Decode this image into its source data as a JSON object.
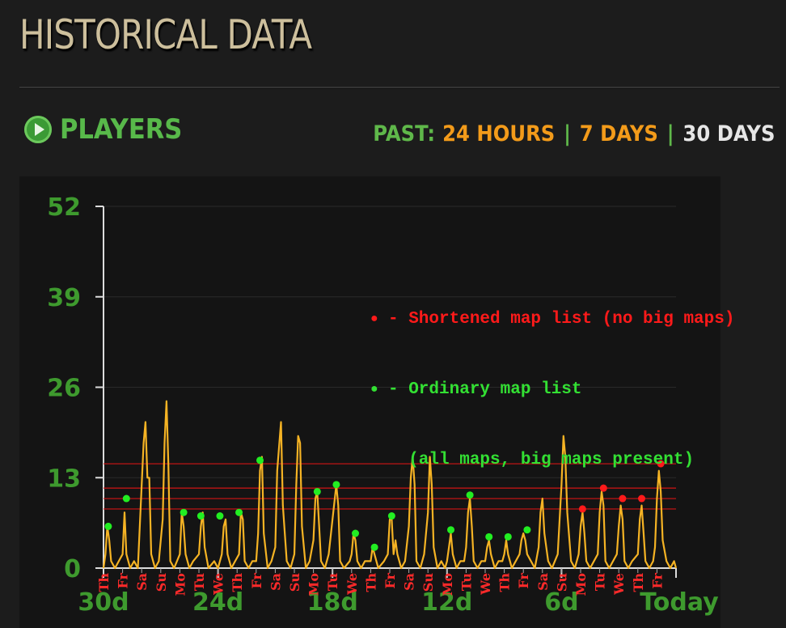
{
  "page": {
    "title": "HISTORICAL DATA"
  },
  "section": {
    "title": "PLAYERS"
  },
  "period_nav": {
    "label": "PAST:",
    "options": [
      {
        "label": "24 HOURS",
        "active": false
      },
      {
        "label": "7 DAYS",
        "active": false
      },
      {
        "label": "30 DAYS",
        "active": true
      }
    ],
    "separator": "|"
  },
  "legend": {
    "red_text": "- Shortened map list (no big maps)",
    "green_text_1": "- Ordinary map list",
    "green_text_2": "  (all maps, big maps present)"
  },
  "colors": {
    "line": "#f5b324",
    "axis_labels": "#3e9a2e",
    "day_labels": "#ff2a2a",
    "red_marker": "#ff1a1a",
    "green_marker": "#22ee22",
    "reference_line": "#d01515"
  },
  "chart_data": {
    "type": "line",
    "ylim": [
      0,
      52
    ],
    "yticks": [
      "0",
      "13",
      "26",
      "39",
      "52"
    ],
    "xlim": [
      0,
      30
    ],
    "x_major_labels": [
      {
        "x": 0,
        "label": "30d"
      },
      {
        "x": 6,
        "label": "24d"
      },
      {
        "x": 12,
        "label": "18d"
      },
      {
        "x": 18,
        "label": "12d"
      },
      {
        "x": 24,
        "label": "6d"
      },
      {
        "x": 30,
        "label": "Today"
      }
    ],
    "day_labels": [
      "Th",
      "Fr",
      "Sa",
      "Su",
      "Mo",
      "Tu",
      "We",
      "Th",
      "Fr",
      "Sa",
      "Su",
      "Mo",
      "Tu",
      "We",
      "Th",
      "Fr",
      "Sa",
      "Su",
      "Mo",
      "Tu",
      "We",
      "Th",
      "Fr",
      "Sa",
      "Su",
      "Mo",
      "Tu",
      "We",
      "Th",
      "Fr"
    ],
    "series": [
      {
        "values": [
          [
            0,
            0
          ],
          [
            0.1,
            2
          ],
          [
            0.2,
            6
          ],
          [
            0.3,
            4
          ],
          [
            0.4,
            1
          ],
          [
            0.6,
            0
          ],
          [
            0.8,
            1
          ],
          [
            1,
            2
          ],
          [
            1.1,
            8
          ],
          [
            1.2,
            2
          ],
          [
            1.4,
            0
          ],
          [
            1.6,
            1
          ],
          [
            1.8,
            0
          ],
          [
            2.1,
            18
          ],
          [
            2.2,
            21
          ],
          [
            2.3,
            13
          ],
          [
            2.4,
            13
          ],
          [
            2.5,
            2
          ],
          [
            2.7,
            0
          ],
          [
            2.9,
            1
          ],
          [
            3.1,
            7
          ],
          [
            3.2,
            18
          ],
          [
            3.3,
            24
          ],
          [
            3.4,
            15
          ],
          [
            3.5,
            1
          ],
          [
            3.7,
            0
          ],
          [
            4,
            2
          ],
          [
            4.1,
            8
          ],
          [
            4.2,
            6
          ],
          [
            4.3,
            2
          ],
          [
            4.5,
            0
          ],
          [
            4.7,
            1
          ],
          [
            5,
            2
          ],
          [
            5.1,
            6
          ],
          [
            5.2,
            8
          ],
          [
            5.3,
            3
          ],
          [
            5.5,
            0
          ],
          [
            5.8,
            1
          ],
          [
            6,
            0
          ],
          [
            6.2,
            2
          ],
          [
            6.3,
            6
          ],
          [
            6.4,
            7
          ],
          [
            6.5,
            2
          ],
          [
            6.7,
            0
          ],
          [
            6.9,
            1
          ],
          [
            7.1,
            2
          ],
          [
            7.2,
            8
          ],
          [
            7.3,
            7
          ],
          [
            7.4,
            1
          ],
          [
            7.6,
            0
          ],
          [
            7.8,
            1
          ],
          [
            8,
            1
          ],
          [
            8.1,
            5
          ],
          [
            8.2,
            14
          ],
          [
            8.3,
            16
          ],
          [
            8.4,
            5
          ],
          [
            8.6,
            0
          ],
          [
            8.8,
            1
          ],
          [
            9,
            3
          ],
          [
            9.1,
            14
          ],
          [
            9.3,
            21
          ],
          [
            9.4,
            9
          ],
          [
            9.6,
            1
          ],
          [
            9.8,
            0
          ],
          [
            10,
            2
          ],
          [
            10.1,
            12
          ],
          [
            10.2,
            19
          ],
          [
            10.3,
            18
          ],
          [
            10.4,
            6
          ],
          [
            10.6,
            0
          ],
          [
            10.8,
            1
          ],
          [
            11,
            4
          ],
          [
            11.1,
            10
          ],
          [
            11.2,
            11
          ],
          [
            11.3,
            6
          ],
          [
            11.4,
            1
          ],
          [
            11.6,
            0
          ],
          [
            11.8,
            2
          ],
          [
            12,
            7
          ],
          [
            12.2,
            12
          ],
          [
            12.3,
            9
          ],
          [
            12.4,
            1
          ],
          [
            12.6,
            0
          ],
          [
            12.9,
            1
          ],
          [
            13,
            2
          ],
          [
            13.1,
            5
          ],
          [
            13.2,
            4
          ],
          [
            13.3,
            1
          ],
          [
            13.5,
            0
          ],
          [
            13.7,
            1
          ],
          [
            14,
            1
          ],
          [
            14.1,
            3
          ],
          [
            14.2,
            2
          ],
          [
            14.4,
            0
          ],
          [
            14.7,
            1
          ],
          [
            14.9,
            2
          ],
          [
            15,
            7
          ],
          [
            15.1,
            7
          ],
          [
            15.2,
            2
          ],
          [
            15.3,
            4
          ],
          [
            15.4,
            2
          ],
          [
            15.6,
            0
          ],
          [
            15.8,
            1
          ],
          [
            16,
            6
          ],
          [
            16.1,
            13
          ],
          [
            16.2,
            16
          ],
          [
            16.3,
            12
          ],
          [
            16.4,
            1
          ],
          [
            16.6,
            0
          ],
          [
            16.8,
            2
          ],
          [
            17,
            8
          ],
          [
            17.1,
            16
          ],
          [
            17.2,
            12
          ],
          [
            17.3,
            3
          ],
          [
            17.5,
            0
          ],
          [
            17.7,
            1
          ],
          [
            17.9,
            0
          ],
          [
            18,
            1
          ],
          [
            18.1,
            3
          ],
          [
            18.2,
            5
          ],
          [
            18.3,
            2
          ],
          [
            18.5,
            0
          ],
          [
            18.7,
            1
          ],
          [
            18.9,
            1
          ],
          [
            19,
            3
          ],
          [
            19.1,
            8
          ],
          [
            19.2,
            10
          ],
          [
            19.3,
            6
          ],
          [
            19.4,
            1
          ],
          [
            19.6,
            0
          ],
          [
            19.8,
            1
          ],
          [
            20,
            1
          ],
          [
            20.1,
            3
          ],
          [
            20.2,
            4
          ],
          [
            20.3,
            2
          ],
          [
            20.5,
            0
          ],
          [
            20.7,
            1
          ],
          [
            20.9,
            1
          ],
          [
            21,
            2
          ],
          [
            21.1,
            4
          ],
          [
            21.2,
            2
          ],
          [
            21.4,
            0
          ],
          [
            21.6,
            1
          ],
          [
            21.8,
            2
          ],
          [
            21.9,
            4
          ],
          [
            22,
            5
          ],
          [
            22.1,
            4
          ],
          [
            22.2,
            2
          ],
          [
            22.4,
            1
          ],
          [
            22.6,
            0
          ],
          [
            22.8,
            3
          ],
          [
            22.9,
            8
          ],
          [
            23,
            10
          ],
          [
            23.1,
            5
          ],
          [
            23.3,
            1
          ],
          [
            23.5,
            0
          ],
          [
            23.8,
            2
          ],
          [
            24,
            12
          ],
          [
            24.1,
            19
          ],
          [
            24.2,
            16
          ],
          [
            24.3,
            8
          ],
          [
            24.5,
            1
          ],
          [
            24.7,
            0
          ],
          [
            24.9,
            2
          ],
          [
            25,
            6
          ],
          [
            25.1,
            8
          ],
          [
            25.2,
            5
          ],
          [
            25.3,
            1
          ],
          [
            25.5,
            0
          ],
          [
            25.7,
            1
          ],
          [
            25.9,
            2
          ],
          [
            26,
            8
          ],
          [
            26.1,
            11
          ],
          [
            26.2,
            9
          ],
          [
            26.3,
            1
          ],
          [
            26.5,
            0
          ],
          [
            26.7,
            1
          ],
          [
            26.9,
            2
          ],
          [
            27,
            6
          ],
          [
            27.1,
            9
          ],
          [
            27.2,
            7
          ],
          [
            27.3,
            1
          ],
          [
            27.5,
            0
          ],
          [
            27.7,
            1
          ],
          [
            28,
            2
          ],
          [
            28.1,
            7
          ],
          [
            28.2,
            9
          ],
          [
            28.3,
            5
          ],
          [
            28.4,
            1
          ],
          [
            28.6,
            0
          ],
          [
            28.8,
            1
          ],
          [
            28.9,
            3
          ],
          [
            29,
            10
          ],
          [
            29.1,
            14
          ],
          [
            29.2,
            11
          ],
          [
            29.3,
            4
          ],
          [
            29.5,
            1
          ],
          [
            29.7,
            0
          ],
          [
            29.9,
            1
          ],
          [
            30,
            0
          ]
        ]
      }
    ],
    "green_points": [
      [
        0.25,
        6
      ],
      [
        1.2,
        10
      ],
      [
        4.2,
        8
      ],
      [
        5.1,
        7.5
      ],
      [
        6.1,
        7.5
      ],
      [
        7.1,
        8
      ],
      [
        8.2,
        15.5
      ],
      [
        11.2,
        11
      ],
      [
        12.2,
        12
      ],
      [
        13.2,
        5
      ],
      [
        14.2,
        3
      ],
      [
        15.1,
        7.5
      ],
      [
        18.2,
        5.5
      ],
      [
        19.2,
        10.5
      ],
      [
        20.2,
        4.5
      ],
      [
        21.2,
        4.5
      ],
      [
        22.2,
        5.5
      ]
    ],
    "red_points": [
      [
        25.1,
        8.5
      ],
      [
        26.2,
        11.5
      ],
      [
        27.2,
        10
      ],
      [
        28.2,
        10
      ],
      [
        29.2,
        15
      ]
    ],
    "reference_lines": [
      15,
      11.5,
      10,
      8.5
    ]
  }
}
